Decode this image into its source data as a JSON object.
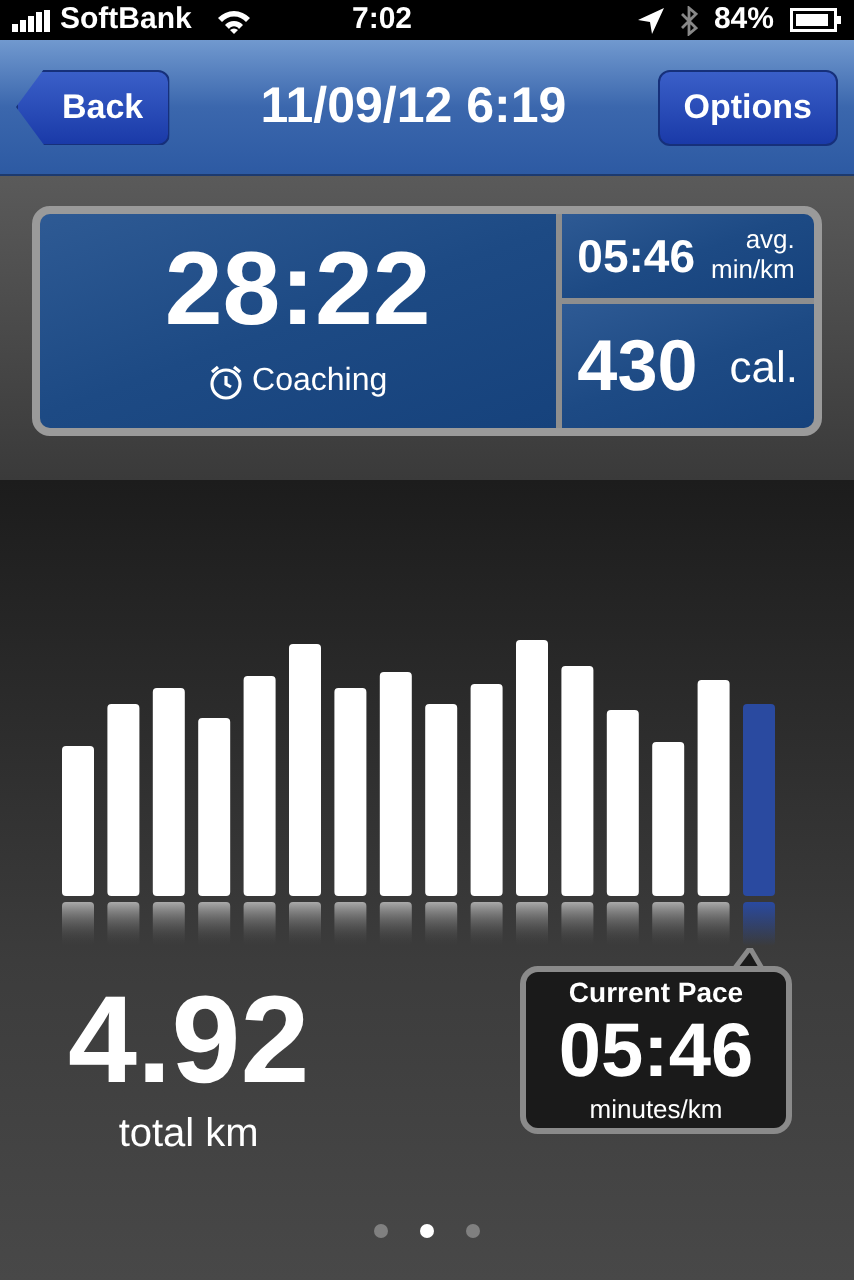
{
  "status_bar": {
    "carrier": "SoftBank",
    "time": "7:02",
    "battery": "84%"
  },
  "nav_bar": {
    "back": "Back",
    "title": "11/09/12 6:19",
    "options": "Options"
  },
  "summary": {
    "duration": "28:22",
    "coaching": "Coaching",
    "avg_pace": "05:46",
    "avg_label_1": "avg.",
    "avg_label_2": "min/km",
    "calories": "430",
    "calories_unit": "cal."
  },
  "pace_bars": [
    {
      "selected": false
    },
    {
      "selected": false
    },
    {
      "selected": false
    },
    {
      "selected": false
    },
    {
      "selected": false
    },
    {
      "selected": false
    },
    {
      "selected": false
    },
    {
      "selected": false
    },
    {
      "selected": false
    },
    {
      "selected": false
    },
    {
      "selected": false
    },
    {
      "selected": false
    },
    {
      "selected": false
    },
    {
      "selected": false
    },
    {
      "selected": false
    },
    {
      "selected": true
    }
  ],
  "distance": {
    "value": "4.92",
    "label": "total km"
  },
  "current_pace": {
    "title": "Current Pace",
    "value": "05:46",
    "unit": "minutes/km"
  },
  "page_dots": [
    {
      "selected": false
    },
    {
      "selected": true
    },
    {
      "selected": false
    }
  ]
}
